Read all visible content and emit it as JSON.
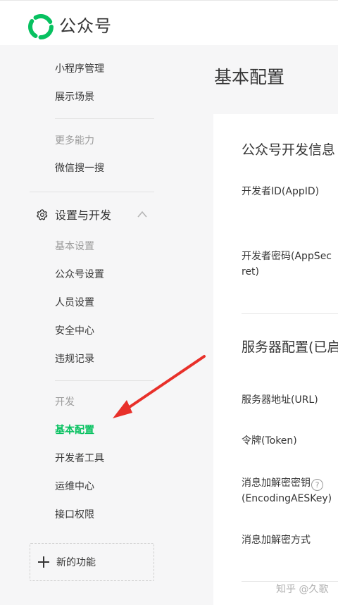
{
  "header": {
    "brand": "公众号",
    "logo_icon": "wechat-official-account-logo-icon"
  },
  "sidebar": {
    "items_top": [
      {
        "label": "小程序管理"
      },
      {
        "label": "展示场景"
      }
    ],
    "more_section_title": "更多能力",
    "more_items": [
      {
        "label": "微信搜一搜"
      }
    ],
    "settings_group": {
      "label": "设置与开发",
      "icon": "gear-icon",
      "expanded_icon": "chevron-up-icon"
    },
    "basic_settings_title": "基本设置",
    "basic_settings_items": [
      {
        "label": "公众号设置"
      },
      {
        "label": "人员设置"
      },
      {
        "label": "安全中心"
      },
      {
        "label": "违规记录"
      }
    ],
    "dev_title": "开发",
    "dev_items": [
      {
        "label": "基本配置",
        "active": true
      },
      {
        "label": "开发者工具"
      },
      {
        "label": "运维中心"
      },
      {
        "label": "接口权限"
      }
    ],
    "new_function": {
      "label": "新的功能",
      "icon": "plus-icon"
    }
  },
  "main": {
    "title": "基本配置",
    "dev_info": {
      "title": "公众号开发信息",
      "appid_label": "开发者ID(AppID)",
      "secret_label": "开发者密码(AppSecret)"
    },
    "server_config": {
      "title": "服务器配置(已启",
      "url_label": "服务器地址(URL)",
      "token_label": "令牌(Token)",
      "aeskey_label": "消息加解密密钥",
      "aeskey_label2": "(EncodingAESKey)",
      "encrypt_mode_label": "消息加解密方式"
    }
  },
  "watermark": "知乎 @久歌",
  "colors": {
    "accent": "#07c160",
    "annotation_arrow": "#e8302a"
  }
}
